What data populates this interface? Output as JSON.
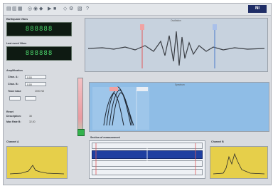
{
  "labels": {
    "top_lcd_label": "Earthquake Vibes",
    "bottom_lcd_label": "Last event Vibes",
    "amplification": "Amplification",
    "chan_a": "Chan. A:",
    "chan_b": "Chan. B:",
    "trace_base": "Trace base",
    "trace_base_value": "2000 NS",
    "reset": "Reset",
    "description": "Description:",
    "description_value": "38",
    "max_rate": "Max Rate B:",
    "max_rate_value": "32,00",
    "channel_a": "Channel A",
    "channel_b": "Channel B",
    "section_of_measurement": "Section of measurement",
    "top_plot_title": "Oscillation",
    "mid_plot_title": "Spectrum"
  },
  "lcd": {
    "top": "888888",
    "bottom": "888888"
  },
  "inputs": {
    "chan_a": "0.00",
    "chan_b": "0.00"
  },
  "colors": {
    "plot_bg": "#c7d2de",
    "spectrum_bg": "#8fbde6",
    "mini_bg": "#e6cf4a",
    "marker_red": "#e25a5a",
    "marker_blue": "#4a79c9",
    "selection_blue": "#1f3fa0"
  }
}
